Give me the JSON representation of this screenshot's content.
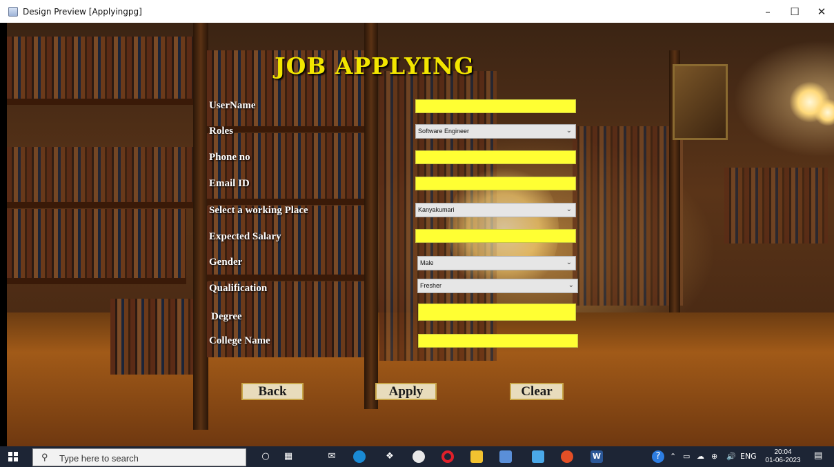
{
  "window": {
    "title": "Design Preview [Applyingpg]",
    "controls": {
      "minimize": "–",
      "maximize": "☐",
      "close": "✕"
    }
  },
  "form": {
    "heading": "JOB APPLYING",
    "fields": {
      "username": {
        "label": "UserName",
        "value": ""
      },
      "roles": {
        "label": "Roles",
        "selected": "Software Engineer"
      },
      "phone": {
        "label": "Phone no",
        "value": ""
      },
      "email": {
        "label": "Email ID",
        "value": ""
      },
      "working_place": {
        "label": "Select a working Place",
        "selected": "Kanyakumari"
      },
      "expected_salary": {
        "label": "Expected Salary",
        "value": ""
      },
      "gender": {
        "label": "Gender",
        "selected": "Male"
      },
      "qualification": {
        "label": "Qualification",
        "selected": "Fresher"
      },
      "degree": {
        "label": "Degree",
        "value": ""
      },
      "college_name": {
        "label": "College Name",
        "value": ""
      }
    },
    "buttons": {
      "back": "Back",
      "apply": "Apply",
      "clear": "Clear"
    }
  },
  "taskbar": {
    "search_placeholder": "Type here to search",
    "language": "ENG",
    "time": "20:04",
    "date": "01-06-2023"
  },
  "colors": {
    "heading": "#f3e600",
    "field_fill": "#ffff66",
    "taskbar": "#1d2535"
  }
}
